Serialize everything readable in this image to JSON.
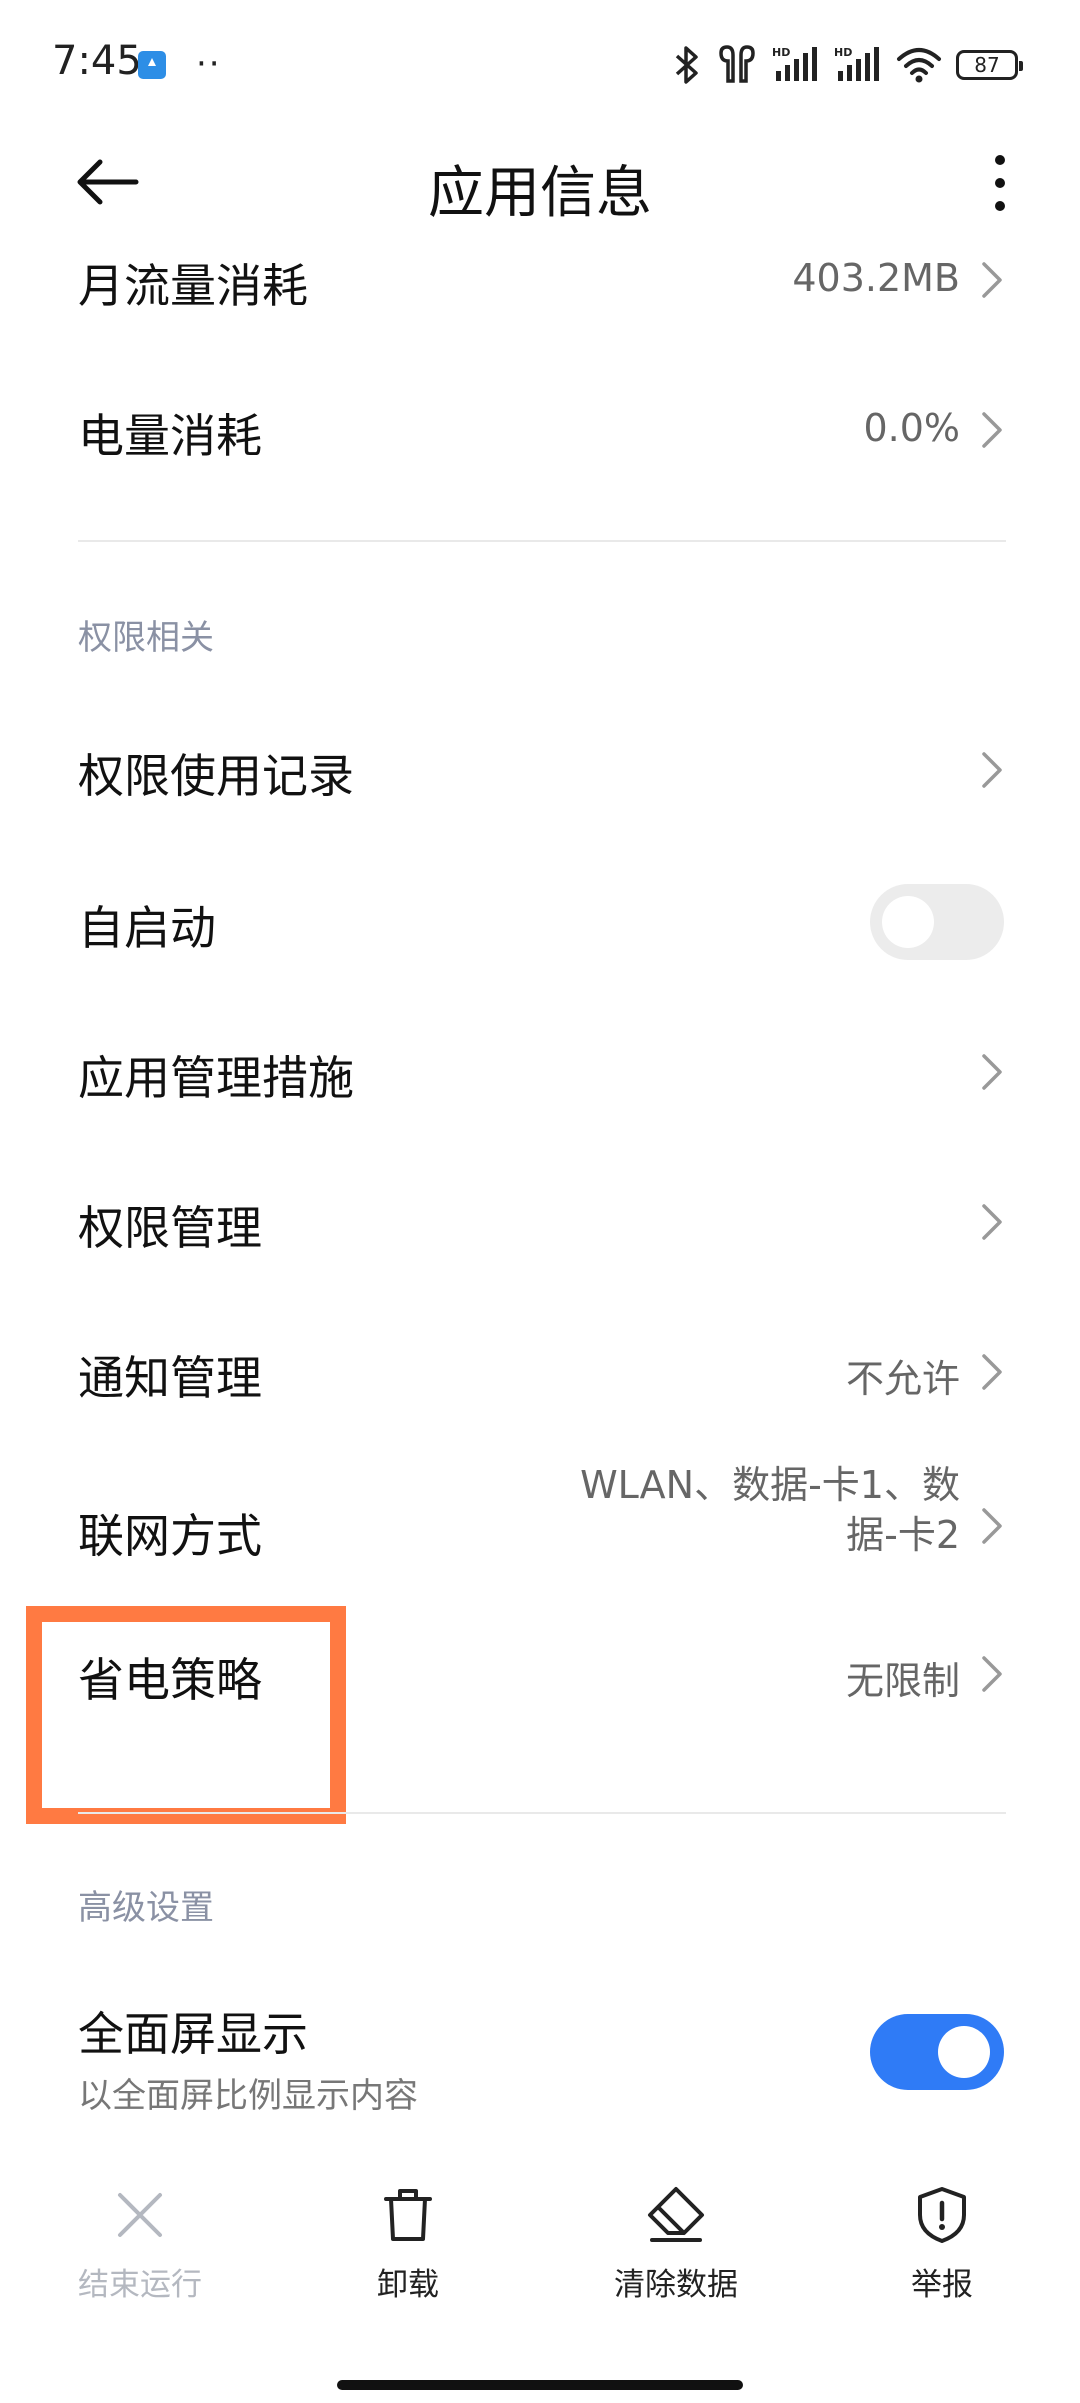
{
  "status_bar": {
    "time": "7:45",
    "dots": "··",
    "battery": "87",
    "icons": [
      "notification-icon",
      "bluetooth-icon",
      "earbuds-icon",
      "signal-hd-icon",
      "signal-hd-icon",
      "wifi-icon",
      "battery-icon"
    ]
  },
  "header": {
    "title": "应用信息",
    "icons": [
      "back-arrow-icon",
      "more-vertical-icon"
    ]
  },
  "rows": {
    "monthly_data": {
      "label": "月流量消耗",
      "value": "403.2MB"
    },
    "battery_usage": {
      "label": "电量消耗",
      "value": "0.0%"
    },
    "permission_log": {
      "label": "权限使用记录"
    },
    "autostart": {
      "label": "自启动",
      "toggle": false
    },
    "app_management": {
      "label": "应用管理措施"
    },
    "permission_manage": {
      "label": "权限管理"
    },
    "notification_manage": {
      "label": "通知管理",
      "value": "不允许"
    },
    "network": {
      "label": "联网方式",
      "value_line1": "WLAN、数据-卡1、数",
      "value_line2": "据-卡2"
    },
    "power_saving": {
      "label": "省电策略",
      "value": "无限制"
    },
    "fullscreen": {
      "label": "全面屏显示",
      "sublabel": "以全面屏比例显示内容",
      "toggle": true
    }
  },
  "sections": {
    "permissions": "权限相关",
    "advanced": "高级设置"
  },
  "bottom_bar": {
    "stop": "结束运行",
    "uninstall": "卸载",
    "clear_data": "清除数据",
    "report": "举报"
  },
  "colors": {
    "accent": "#2f7bf6",
    "highlight": "#ff7a42",
    "section_title": "#8a91a4"
  }
}
